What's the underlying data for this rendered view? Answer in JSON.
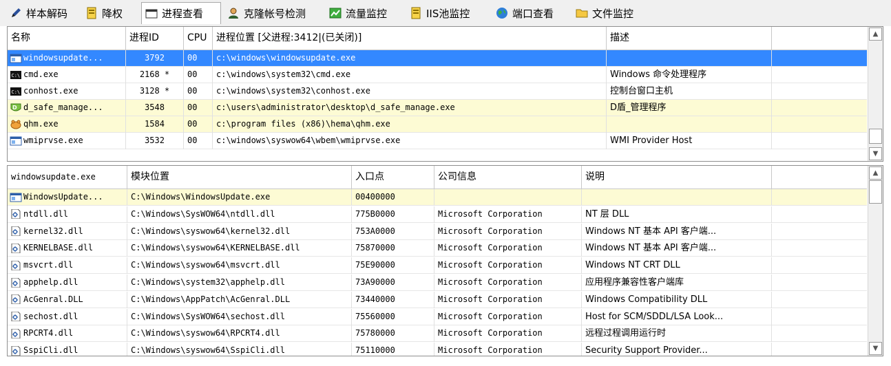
{
  "tabs": [
    {
      "label": "样本解码",
      "icon": "pencil-icon"
    },
    {
      "label": "降权",
      "icon": "document-icon"
    },
    {
      "label": "进程查看",
      "icon": "window-icon"
    },
    {
      "label": "克隆帐号检测",
      "icon": "user-icon"
    },
    {
      "label": "流量监控",
      "icon": "chart-icon"
    },
    {
      "label": "IIS池监控",
      "icon": "document-icon"
    },
    {
      "label": "端口查看",
      "icon": "globe-icon"
    },
    {
      "label": "文件监控",
      "icon": "folder-icon"
    }
  ],
  "process_grid": {
    "columns": [
      "名称",
      "进程ID",
      "CPU",
      "进程位置  [父进程:3412|(已关闭)]",
      "描述"
    ],
    "rows": [
      {
        "name": "windowsupdate...",
        "pid": "3792",
        "cpu": "00",
        "path": "c:\\windows\\windowsupdate.exe",
        "desc": "",
        "icon": "window-icon",
        "state": "selected"
      },
      {
        "name": "cmd.exe",
        "pid": "2168 *",
        "cpu": "00",
        "path": "c:\\windows\\system32\\cmd.exe",
        "desc": "Windows 命令处理程序",
        "icon": "console-icon",
        "state": ""
      },
      {
        "name": "conhost.exe",
        "pid": "3128 *",
        "cpu": "00",
        "path": "c:\\windows\\system32\\conhost.exe",
        "desc": "控制台窗口主机",
        "icon": "console-icon",
        "state": ""
      },
      {
        "name": "d_safe_manage...",
        "pid": "3548",
        "cpu": "00",
        "path": "c:\\users\\administrator\\desktop\\d_safe_manage.exe",
        "desc": "D盾_管理程序",
        "icon": "dshield-icon",
        "state": "yellow"
      },
      {
        "name": "qhm.exe",
        "pid": "1584",
        "cpu": "00",
        "path": "c:\\program files (x86)\\hema\\qhm.exe",
        "desc": "",
        "icon": "hippo-icon",
        "state": "yellow"
      },
      {
        "name": "wmiprvse.exe",
        "pid": "3532",
        "cpu": "00",
        "path": "c:\\windows\\syswow64\\wbem\\wmiprvse.exe",
        "desc": "WMI Provider Host",
        "icon": "window-icon",
        "state": ""
      }
    ]
  },
  "module_grid": {
    "columns": [
      "windowsupdate.exe",
      "模块位置",
      "入口点",
      "公司信息",
      "说明"
    ],
    "rows": [
      {
        "name": "WindowsUpdate...",
        "path": "C:\\Windows\\WindowsUpdate.exe",
        "entry": "00400000",
        "company": "",
        "desc": "",
        "icon": "window-icon",
        "state": "yellow"
      },
      {
        "name": "ntdll.dll",
        "path": "C:\\Windows\\SysWOW64\\ntdll.dll",
        "entry": "775B0000",
        "company": "Microsoft Corporation",
        "desc": "NT 层 DLL",
        "icon": "dll-icon",
        "state": ""
      },
      {
        "name": "kernel32.dll",
        "path": "C:\\Windows\\syswow64\\kernel32.dll",
        "entry": "753A0000",
        "company": "Microsoft Corporation",
        "desc": "Windows NT 基本 API 客户端...",
        "icon": "dll-icon",
        "state": ""
      },
      {
        "name": "KERNELBASE.dll",
        "path": "C:\\Windows\\syswow64\\KERNELBASE.dll",
        "entry": "75870000",
        "company": "Microsoft Corporation",
        "desc": "Windows NT 基本 API 客户端...",
        "icon": "dll-icon",
        "state": ""
      },
      {
        "name": "msvcrt.dll",
        "path": "C:\\Windows\\syswow64\\msvcrt.dll",
        "entry": "75E90000",
        "company": "Microsoft Corporation",
        "desc": "Windows NT CRT DLL",
        "icon": "dll-icon",
        "state": ""
      },
      {
        "name": "apphelp.dll",
        "path": "C:\\Windows\\system32\\apphelp.dll",
        "entry": "73A90000",
        "company": "Microsoft Corporation",
        "desc": "应用程序兼容性客户端库",
        "icon": "dll-icon",
        "state": ""
      },
      {
        "name": "AcGenral.DLL",
        "path": "C:\\Windows\\AppPatch\\AcGenral.DLL",
        "entry": "73440000",
        "company": "Microsoft Corporation",
        "desc": "Windows Compatibility DLL",
        "icon": "dll-icon",
        "state": ""
      },
      {
        "name": "sechost.dll",
        "path": "C:\\Windows\\SysWOW64\\sechost.dll",
        "entry": "75560000",
        "company": "Microsoft Corporation",
        "desc": "Host for SCM/SDDL/LSA Look...",
        "icon": "dll-icon",
        "state": ""
      },
      {
        "name": "RPCRT4.dll",
        "path": "C:\\Windows\\syswow64\\RPCRT4.dll",
        "entry": "75780000",
        "company": "Microsoft Corporation",
        "desc": "远程过程调用运行时",
        "icon": "dll-icon",
        "state": ""
      },
      {
        "name": "SspiCli.dll",
        "path": "C:\\Windows\\syswow64\\SspiCli.dll",
        "entry": "75110000",
        "company": "Microsoft Corporation",
        "desc": "Security Support Provider...",
        "icon": "dll-icon",
        "state": ""
      }
    ]
  },
  "colors": {
    "selection": "#3388ff",
    "highlight_row": "#fdfbd4"
  }
}
